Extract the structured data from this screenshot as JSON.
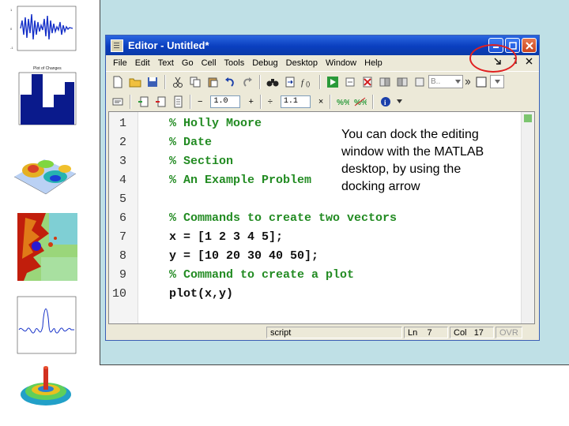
{
  "thumbnails": [
    {
      "name": "signal-plot-thumbnail"
    },
    {
      "name": "histogram-thumbnail",
      "title": "Plot of Changes"
    },
    {
      "name": "surface-plot-thumbnail"
    },
    {
      "name": "fractal-image-thumbnail"
    },
    {
      "name": "sinc-line-plot-thumbnail"
    },
    {
      "name": "3d-surface-thumbnail"
    }
  ],
  "editor": {
    "title": "Editor - Untitled*",
    "menu": [
      "File",
      "Edit",
      "Text",
      "Go",
      "Cell",
      "Tools",
      "Debug",
      "Desktop",
      "Window",
      "Help"
    ],
    "cell_bar": {
      "minus": "−",
      "value1": "1.0",
      "plus": "+",
      "divide": "÷",
      "value2": "1.1",
      "times": "×"
    },
    "stack_combo": "B..",
    "lines": [
      {
        "num": "1",
        "text": "% Holly Moore",
        "kind": "comment"
      },
      {
        "num": "2",
        "text": "% Date",
        "kind": "comment"
      },
      {
        "num": "3",
        "text": "% Section",
        "kind": "comment"
      },
      {
        "num": "4",
        "text": "% An Example Problem",
        "kind": "comment"
      },
      {
        "num": "5",
        "text": "",
        "kind": "normal"
      },
      {
        "num": "6",
        "text": "% Commands to create two vectors",
        "kind": "comment"
      },
      {
        "num": "7",
        "text": "x = [1 2 3 4 5];",
        "kind": "normal"
      },
      {
        "num": "8",
        "text": "y = [10 20 30 40 50];",
        "kind": "normal"
      },
      {
        "num": "9",
        "text": "% Command to create a plot",
        "kind": "comment"
      },
      {
        "num": "10",
        "text": "plot(x,y)",
        "kind": "normal"
      }
    ],
    "status": {
      "mode": "script",
      "ln_label": "Ln",
      "ln_value": "7",
      "col_label": "Col",
      "col_value": "17",
      "ovr": "OVR"
    }
  },
  "annotation": "You can dock the editing window with the MATLAB desktop, by using the docking arrow",
  "colors": {
    "comment": "#228b22",
    "title_bar": "#0a3fbf",
    "slide_bg": "#bfe0e6",
    "highlight_circle": "#e02020"
  }
}
